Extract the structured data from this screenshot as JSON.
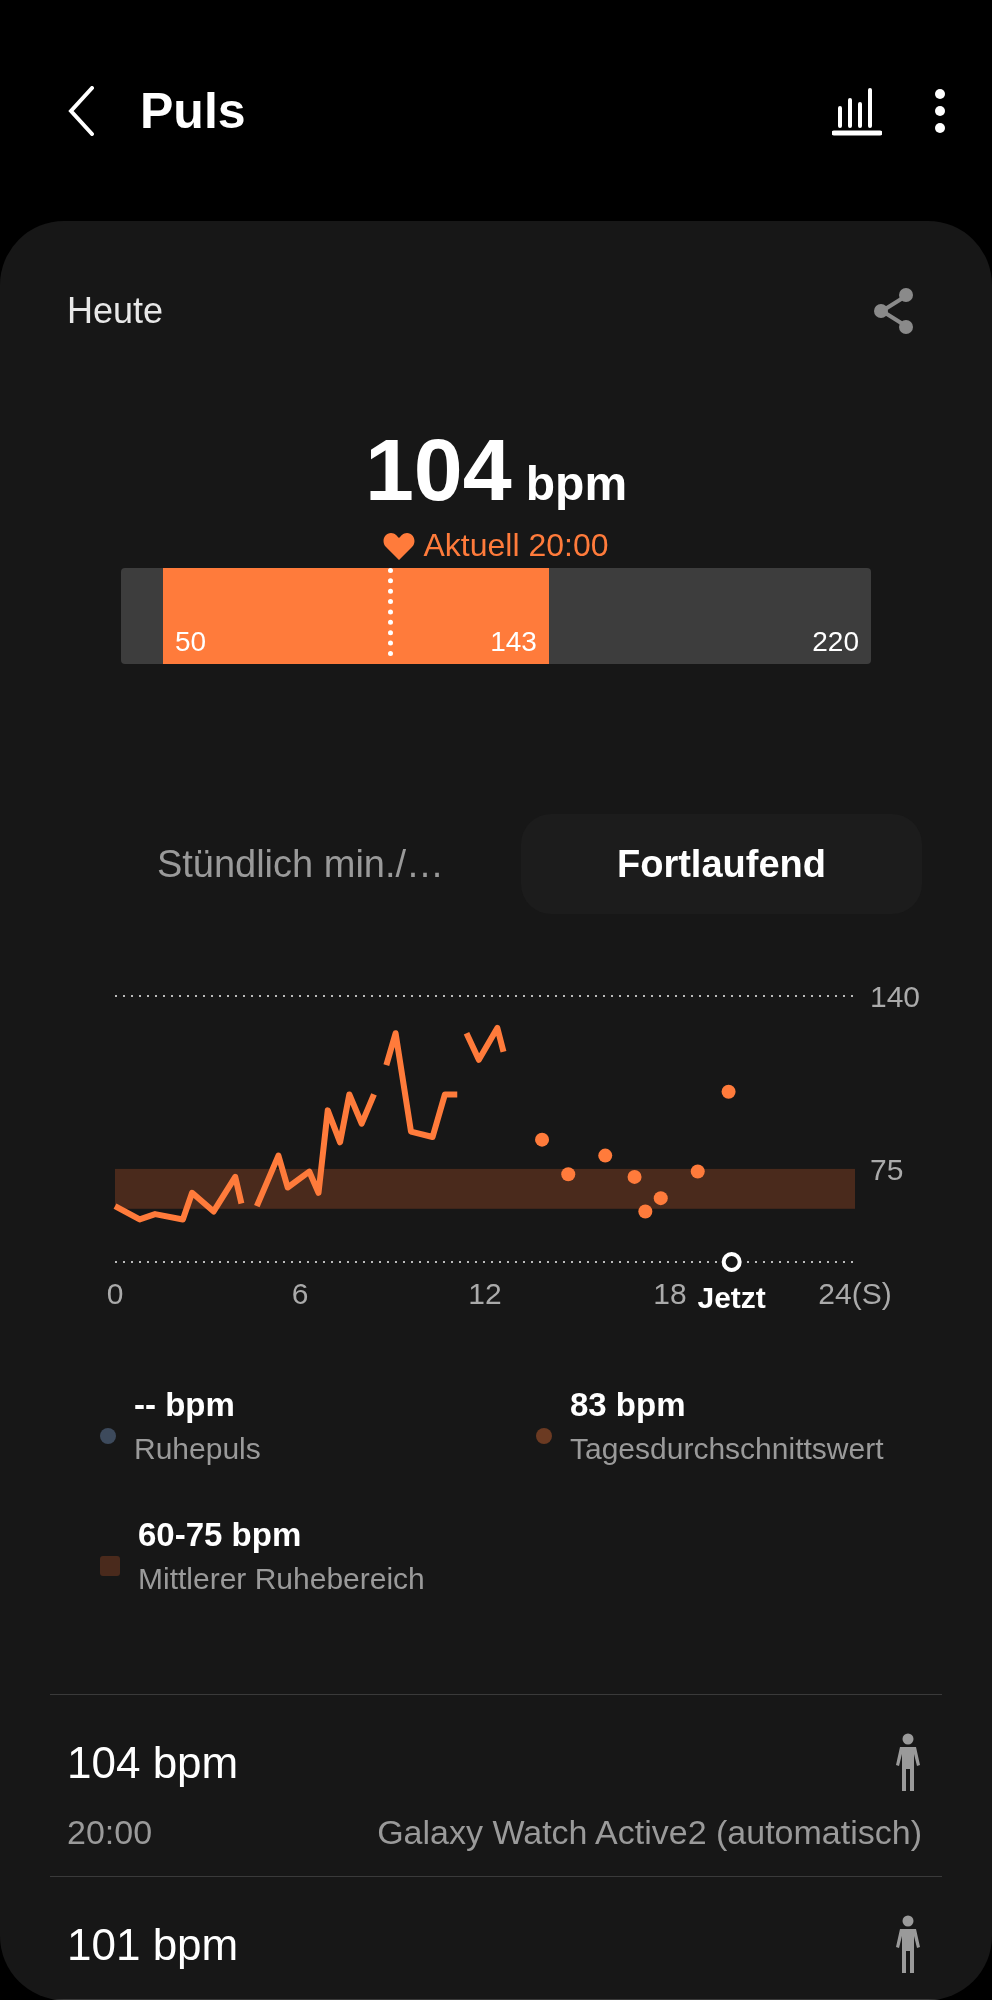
{
  "app_bar": {
    "title": "Puls"
  },
  "summary": {
    "period": "Heute",
    "value": "104",
    "unit": "bpm",
    "caption": "Aktuell 20:00"
  },
  "range_bar": {
    "fill": {
      "level": 0.545,
      "start_label": "50",
      "end_label": "143"
    },
    "end_label": "220",
    "marker": {
      "level": 0.318
    }
  },
  "tabs": [
    {
      "label": "Stündlich min./…",
      "selected": false
    },
    {
      "label": "Fortlaufend",
      "selected": true
    }
  ],
  "chart": {
    "chart_data": {
      "type": "line",
      "x": [
        0,
        0.8,
        1.3,
        2.2,
        2.5,
        3.2,
        3.9,
        4.1,
        4.3,
        4.6,
        5.3,
        5.6,
        6.3,
        6.6,
        6.9,
        7.3,
        7.6,
        8.0,
        8.4,
        8.6,
        8.8,
        9.1,
        9.6,
        10.3,
        10.7,
        11.1,
        11.25,
        11.4,
        11.8,
        12.4,
        12.6,
        13.2,
        13.85,
        14.3,
        14.7,
        15.3,
        15.9,
        16.4,
        16.85,
        17.0,
        17.2,
        17.45,
        17.7,
        18.3,
        18.9,
        19.4,
        19.9
      ],
      "series": [
        {
          "color": "#ff7b3b",
          "values": [
            61,
            56,
            58,
            56,
            66,
            59,
            72,
            62,
            null,
            61,
            80,
            68,
            74,
            66,
            97,
            85,
            103,
            92,
            103,
            null,
            114,
            126,
            89,
            87,
            103,
            103,
            null,
            126,
            116,
            128,
            119,
            null,
            null,
            null,
            null,
            null,
            null,
            null,
            null,
            null,
            null,
            null,
            null,
            null,
            null,
            null,
            null
          ]
        },
        {
          "type": "scatter",
          "color": "#ff7b3b",
          "values": [
            null,
            null,
            null,
            null,
            null,
            null,
            null,
            null,
            null,
            null,
            null,
            null,
            null,
            null,
            null,
            null,
            null,
            null,
            null,
            null,
            null,
            null,
            null,
            null,
            null,
            null,
            null,
            null,
            null,
            null,
            null,
            null,
            86,
            null,
            73,
            null,
            80,
            null,
            72,
            null,
            59,
            null,
            64,
            null,
            74,
            null,
            104
          ]
        }
      ],
      "xlim": [
        0,
        24
      ],
      "ylim": [
        40,
        140
      ],
      "xticks": [
        0,
        6,
        12,
        18,
        {
          "value": 20,
          "label": "Jetzt"
        },
        {
          "value": 24,
          "label": "24(S)"
        }
      ],
      "yticks": [
        75,
        140
      ],
      "bands": [
        {
          "axis": "y",
          "from": 60,
          "to": 75,
          "color": "#4a2a1c"
        }
      ]
    }
  },
  "legend": [
    {
      "kind": "dot",
      "color": "#3d4a5c",
      "value": "-- bpm",
      "label": "Ruhepuls"
    },
    {
      "kind": "dot",
      "color": "#6b3a22",
      "value": "83 bpm",
      "label": "Tagesdurchschnittswert"
    },
    {
      "kind": "square",
      "color": "#4a2a1c",
      "value": "60-75 bpm",
      "label": "Mittlerer Ruhebereich"
    }
  ],
  "readings": [
    {
      "value": "104 bpm",
      "time": "20:00",
      "source": "Galaxy Watch Active2 (automatisch)"
    },
    {
      "value": "101 bpm"
    }
  ]
}
